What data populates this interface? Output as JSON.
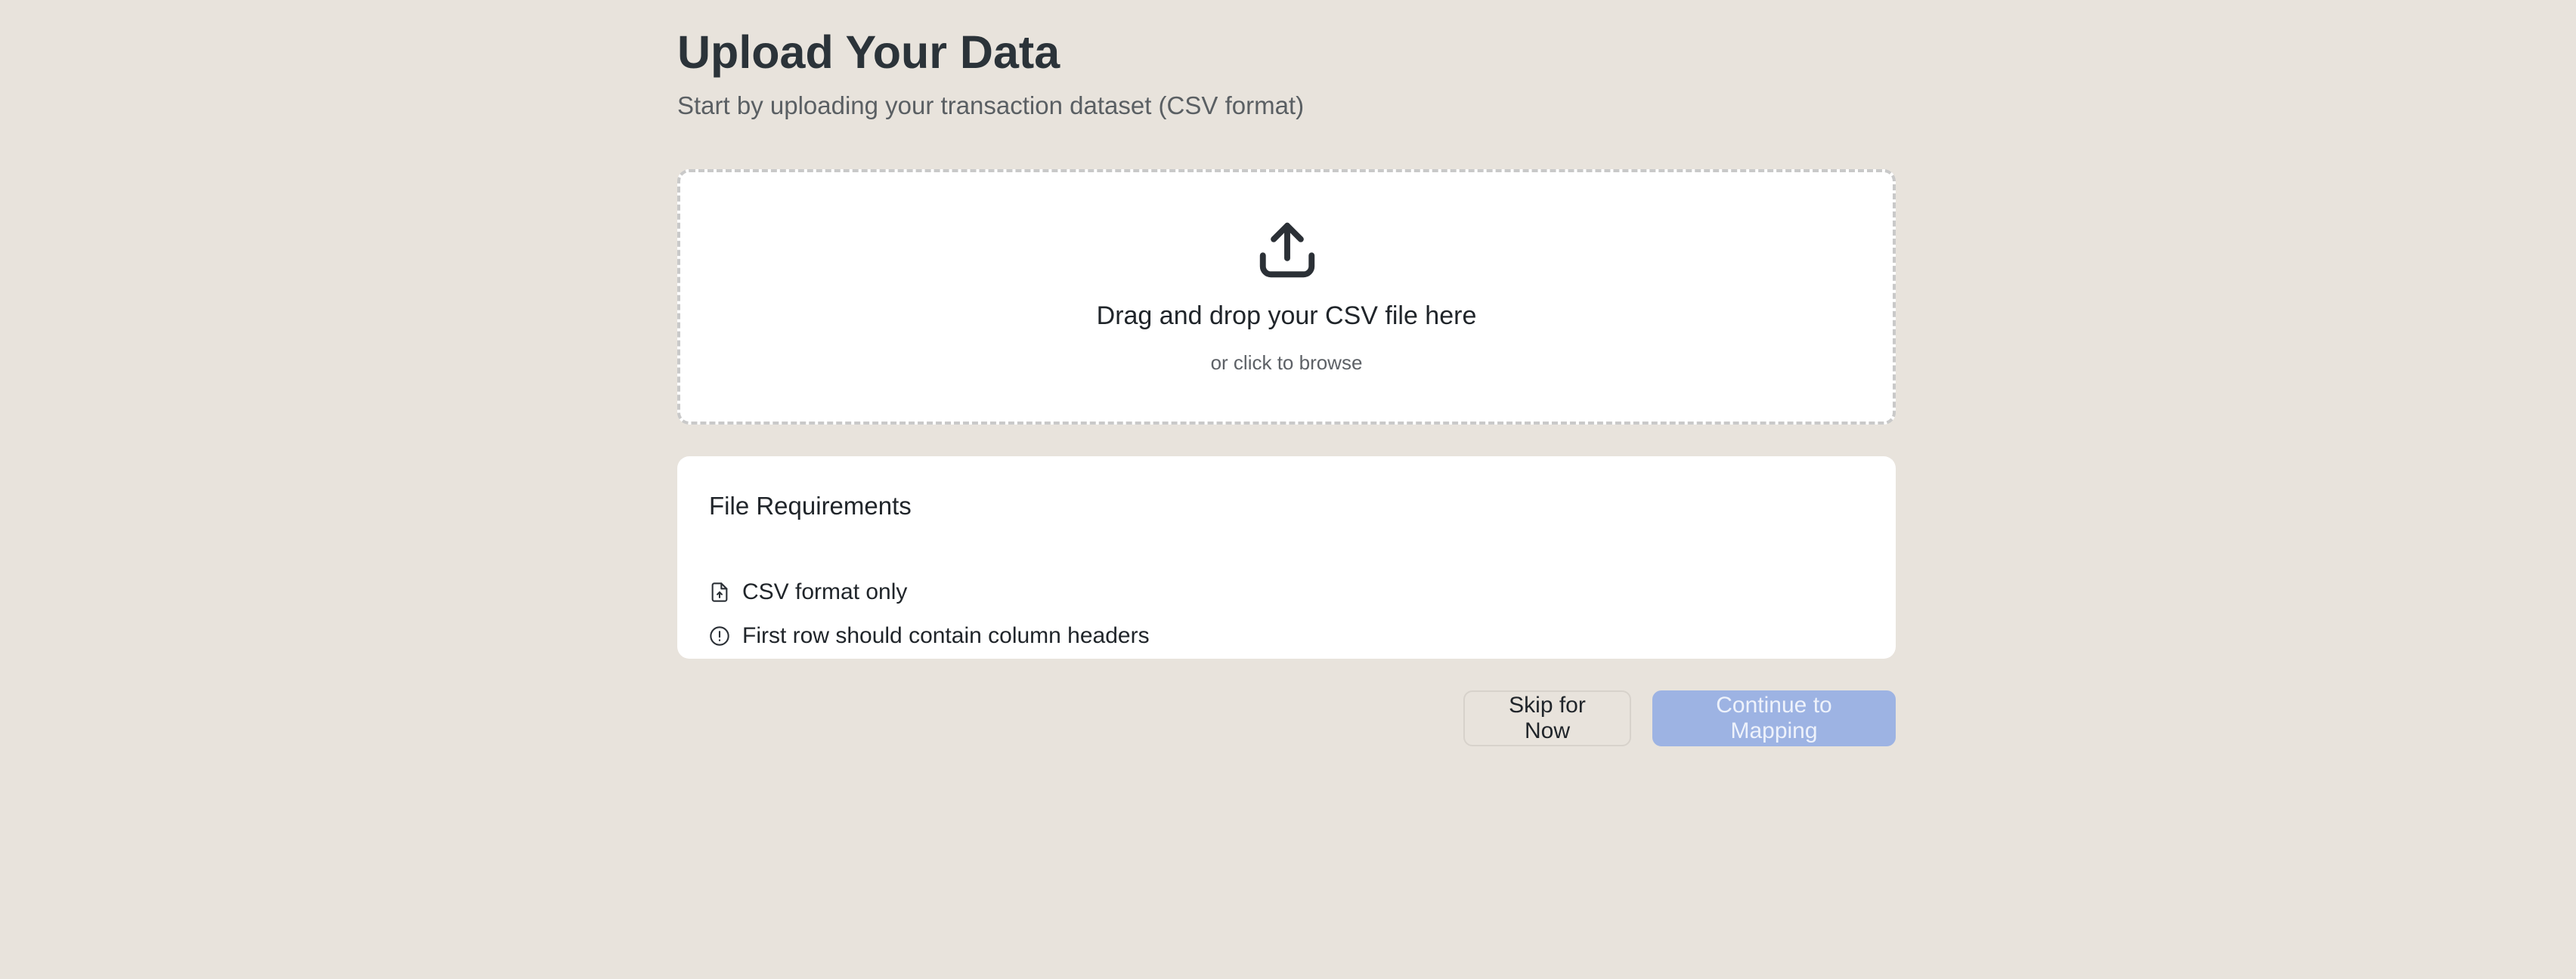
{
  "header": {
    "title": "Upload Your Data",
    "subtitle": "Start by uploading your transaction dataset (CSV format)"
  },
  "dropzone": {
    "icon": "upload-icon",
    "title": "Drag and drop your CSV file here",
    "hint": "or click to browse"
  },
  "requirements": {
    "title": "File Requirements",
    "items": [
      {
        "icon": "file-icon",
        "label": "CSV format only"
      },
      {
        "icon": "alert-circle-icon",
        "label": "First row should contain column headers"
      }
    ]
  },
  "actions": {
    "skip_label": "Skip for Now",
    "continue_label": "Continue to Mapping"
  },
  "colors": {
    "background": "#e8e3dc",
    "primary_disabled": "#9db3e3",
    "text": "#20252a"
  }
}
